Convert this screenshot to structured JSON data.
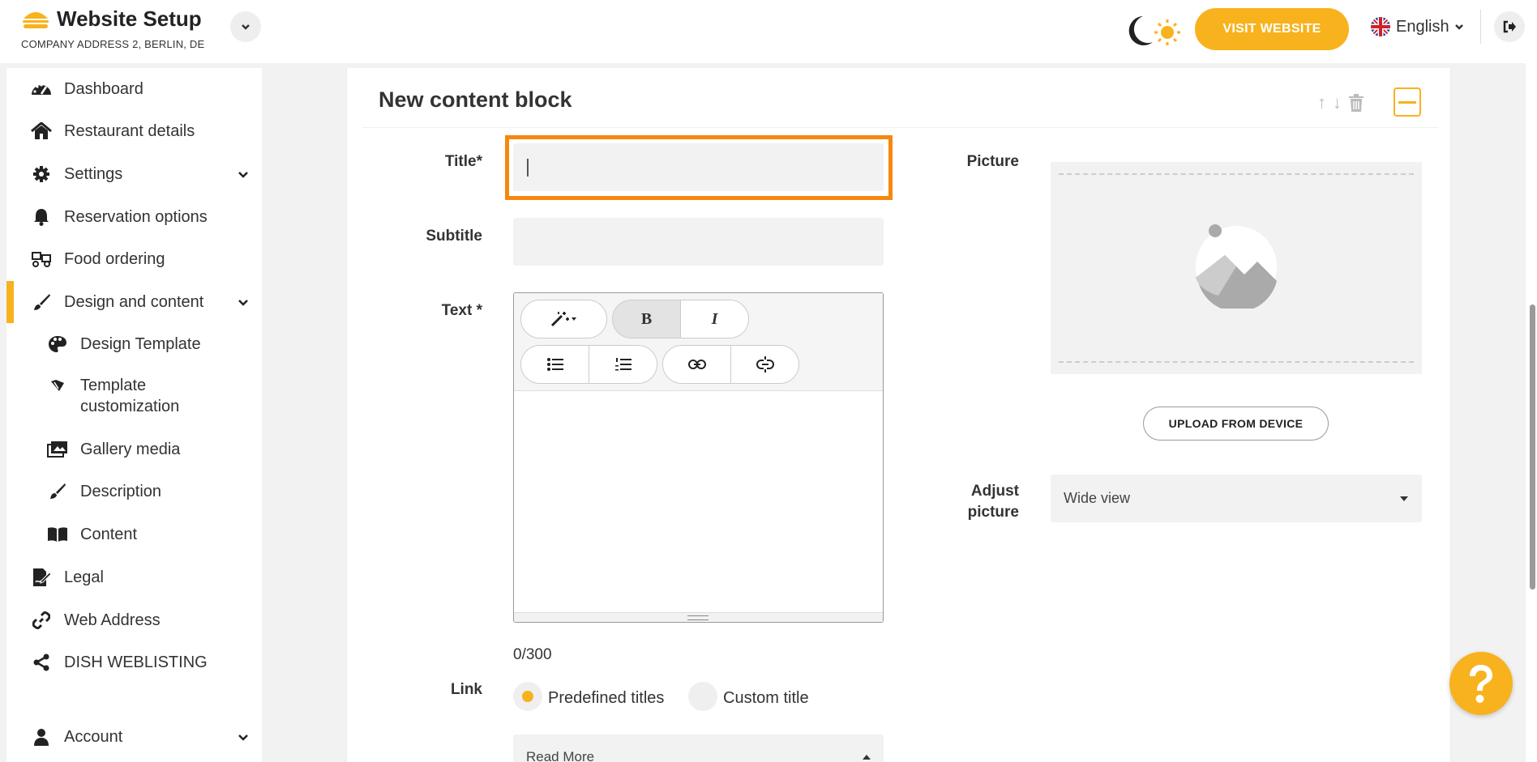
{
  "header": {
    "brand_title": "Website Setup",
    "brand_subtitle": "COMPANY ADDRESS 2, BERLIN, DE",
    "visit_label": "VISIT WEBSITE",
    "language": "English",
    "icons": {
      "brand": "burger-icon",
      "brand_toggle": "chevron-down-icon",
      "theme": "moon-sun-icon",
      "flag": "uk-flag-icon",
      "logout": "logout-icon"
    },
    "accent_color": "#f8b21d"
  },
  "sidebar": {
    "items": [
      {
        "label": "Dashboard",
        "icon": "dashboard-icon"
      },
      {
        "label": "Restaurant details",
        "icon": "home-icon"
      },
      {
        "label": "Settings",
        "icon": "gear-icon"
      },
      {
        "label": "Reservation options",
        "icon": "bell-icon"
      },
      {
        "label": "Food ordering",
        "icon": "food-ordering-icon"
      },
      {
        "label": "Design and content",
        "icon": "brush-icon"
      },
      {
        "label": "Design Template",
        "icon": "palette-icon"
      },
      {
        "label": "Template",
        "icon": "template-icon"
      },
      {
        "label": "customization",
        "icon": ""
      },
      {
        "label": "Gallery media",
        "icon": "gallery-icon"
      },
      {
        "label": "Description",
        "icon": "pen-icon"
      },
      {
        "label": "Content",
        "icon": "book-icon"
      },
      {
        "label": "Legal",
        "icon": "legal-icon"
      },
      {
        "label": "Web Address",
        "icon": "link-icon"
      },
      {
        "label": "DISH WEBLISTING",
        "icon": "share-icon"
      },
      {
        "label": "Account",
        "icon": "user-icon"
      }
    ]
  },
  "block": {
    "title": "New content block",
    "tools": {
      "up": "↑",
      "down": "↓"
    },
    "labels": {
      "title": "Title*",
      "subtitle": "Subtitle",
      "text": "Text *",
      "link": "Link",
      "picture": "Picture",
      "adjust_1": "Adjust",
      "adjust_2": "picture"
    },
    "title_value": "",
    "subtitle_value": "",
    "editor": {
      "bold": "B",
      "italic": "I"
    },
    "counter": "0/300",
    "link_options": [
      "Predefined titles",
      "Custom title"
    ],
    "link_selected": "Predefined titles",
    "link_value": "Read More",
    "upload_label": "UPLOAD FROM DEVICE",
    "adjust_value": "Wide view"
  }
}
